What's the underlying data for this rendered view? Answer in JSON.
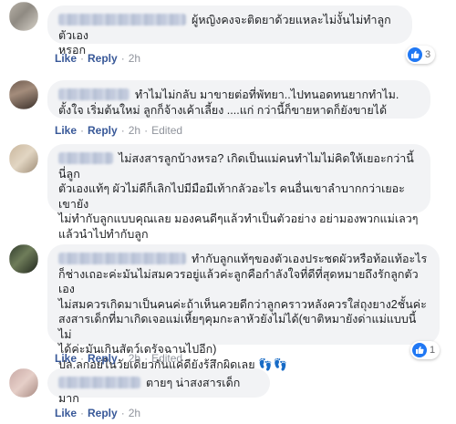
{
  "comments": [
    {
      "text": "ผู้หญิงคงจะติดยาด้วยแหละไม่งั้นไม่ทำลูกตัวเอง\nหรอก",
      "like": "Like",
      "reply": "Reply",
      "time": "2h",
      "reaction_count": "3",
      "avatar_colors": [
        "#b8b2a8",
        "#8f8a82",
        "#d7d2c9"
      ]
    },
    {
      "text": "ทำไมไม่กลับ มาขายต่อที่พัทยา..ไปทนอดทนยากทำไม.\nตั้งใจ เริ่มต้นใหม่ ลูกก็จ้างเค้าเลี้ยง ....แก่ กว่านี้ก็ขายหาดก็ยังขายได้",
      "like": "Like",
      "reply": "Reply",
      "time": "2h",
      "edited": "Edited",
      "avatar_colors": [
        "#6e5a4e",
        "#a48d7c",
        "#3a2f2a"
      ]
    },
    {
      "text": "ไม่สงสารลูกบ้างหรอ? เกิดเป็นแม่คนทำไมไม่คิดให้เยอะกว่านี้ นี่ลูก\nตัวเองแท้ๆ ผัวไม่ดีก็เลิกไปมีมือมีเท้ากลัวอะไร คนอื่นเขาลำบากกว่าเยอะเขายัง\nไม่ทำกับลูกแบบคุณเลย มองคนดีๆแล้วทำเป็นตัวอย่าง อย่ามองพวกแม่เลวๆ\nแล้วนำไปทำกับลูก",
      "like": "Like",
      "reply": "Reply",
      "time": "2h",
      "avatar_colors": [
        "#c9b59c",
        "#e2d6c3",
        "#9c8a74"
      ]
    },
    {
      "text": "ทำกับลูกแท้ๆของตัวเองประชดผัวหรือท้อแท้อะไร\nก็ช่างเถอะค่ะมันไม่สมควรอยู่แล้วค่ะลูกคือกำลังใจที่ดีที่สุดหมายถึงรักลูกตัวเอง\nไม่สมควรเกิดมาเป็นคนค่ะถ้าเห็นควยดีกว่าลูกคราวหลังควรใส่ถุงยาง2ชั้นค่ะ\nสงสารเด็กที่มาเกิดเจอแม่เหี้ยๆคุมกะลาหัวยังไม่ได้(ขาติหมายังด่าแม่แบบนี้ไม่\nได้ค่ะมันเกินสัตว์เดรัจฉานไปอีก)\nปล.ลูกอยู่ในวัยเดียวกันแค่ดียังรู้สึกผิดเลย",
      "feet": "👣👣",
      "like": "Like",
      "reply": "Reply",
      "time": "2h",
      "edited": "Edited",
      "reaction_count": "1",
      "avatar_colors": [
        "#2f3a2c",
        "#6f7d5a",
        "#1e241b"
      ]
    },
    {
      "text": "ตายๆ น่าสงสารเด็กมาก",
      "like": "Like",
      "reply": "Reply",
      "time": "2h",
      "avatar_colors": [
        "#c8a8a4",
        "#e6cfc8",
        "#a58880"
      ]
    }
  ]
}
